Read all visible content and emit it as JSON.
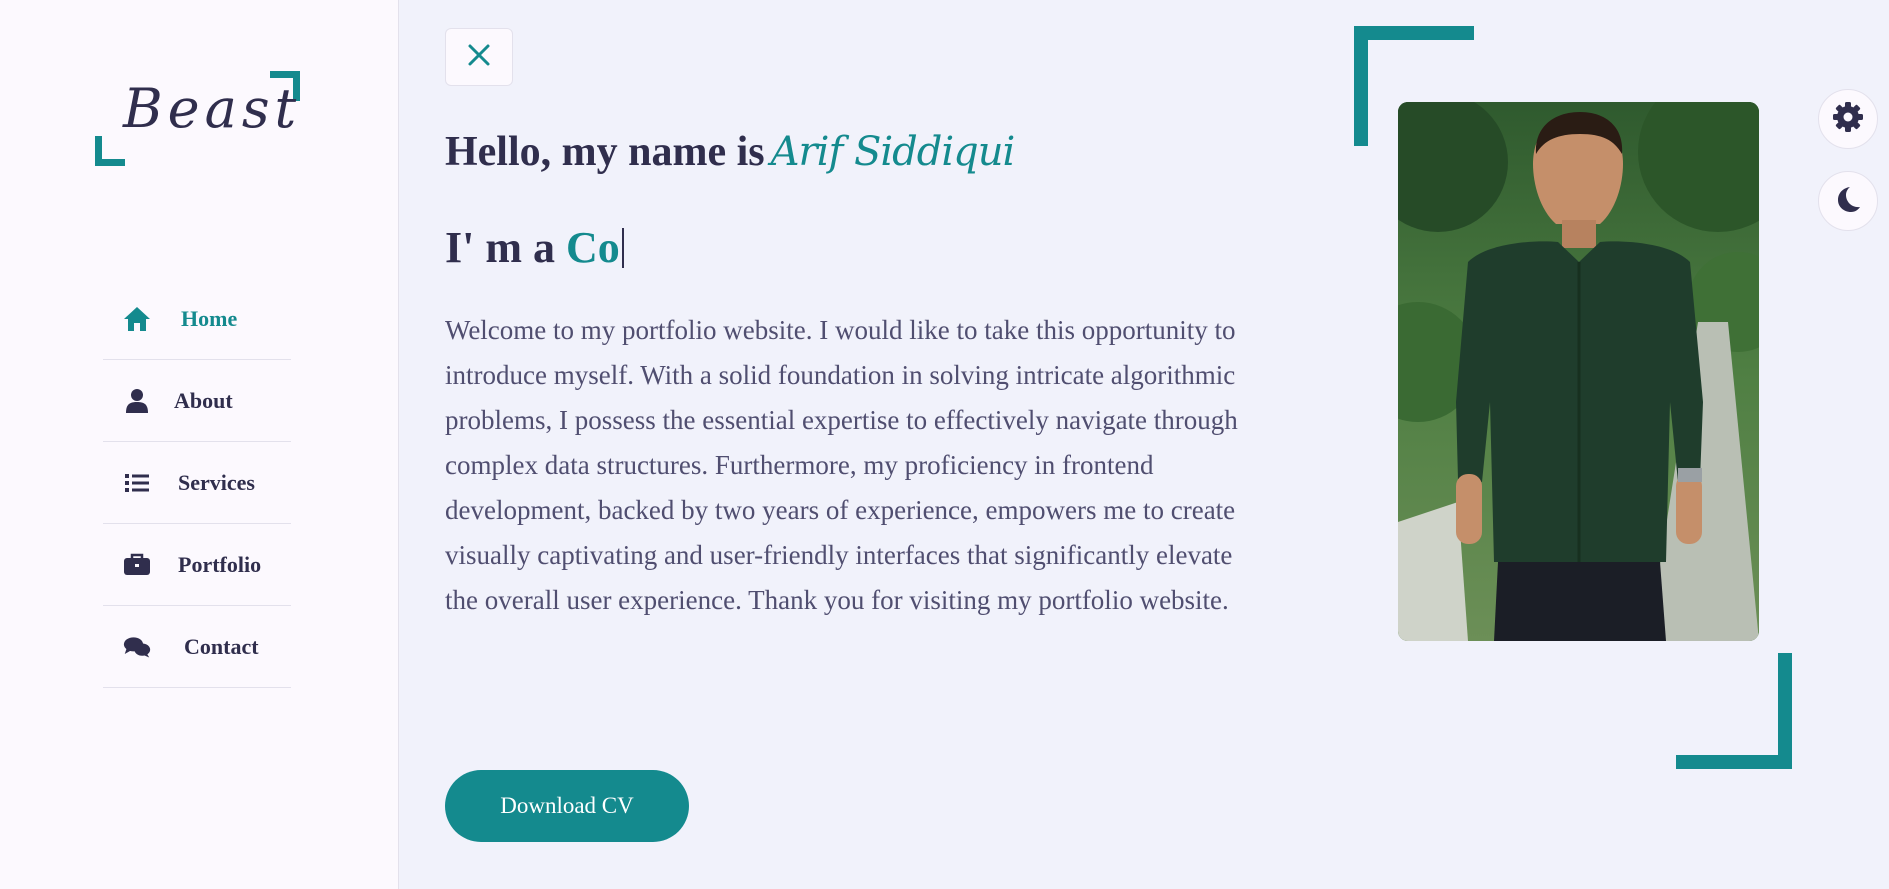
{
  "logo": {
    "text": "Beast"
  },
  "nav": {
    "items": [
      {
        "label": "Home",
        "icon": "home-icon",
        "active": true
      },
      {
        "label": "About",
        "icon": "user-icon",
        "active": false
      },
      {
        "label": "Services",
        "icon": "list-icon",
        "active": false
      },
      {
        "label": "Portfolio",
        "icon": "briefcase-icon",
        "active": false
      },
      {
        "label": "Contact",
        "icon": "comments-icon",
        "active": false
      }
    ]
  },
  "close_button": {
    "icon": "close-icon"
  },
  "hero": {
    "greeting": "Hello, my name is",
    "name": "Arif Siddiqui",
    "role_prefix": "I' m a",
    "role_typed": "Co",
    "intro": "Welcome to my portfolio website. I would like to take this opportunity to introduce myself. With a solid foundation in solving intricate algorithmic problems, I possess the essential expertise to effectively navigate through complex data structures. Furthermore, my proficiency in frontend development, backed by two years of experience, empowers me to create visually captivating and user-friendly interfaces that significantly elevate the overall user experience. Thank you for visiting my portfolio website.",
    "download_label": "Download CV"
  },
  "style_switcher": {
    "settings_icon": "gear-icon",
    "theme_icon": "moon-icon"
  },
  "colors": {
    "accent": "#148a8e",
    "text_dark": "#302e4d",
    "text_muted": "#504e70",
    "background": "#f1f2fb",
    "sidebar_background": "#fcf9fe"
  }
}
